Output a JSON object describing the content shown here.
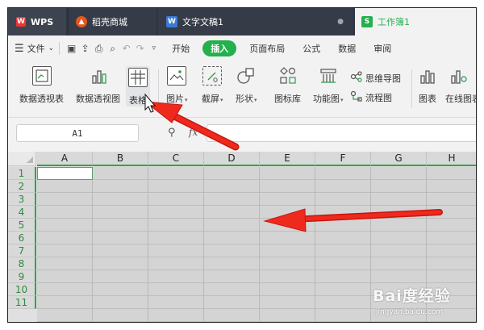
{
  "tabs": [
    {
      "label": "WPS",
      "icon": "wps-logo-icon"
    },
    {
      "label": "稻壳商城",
      "icon": "docer-flame-icon"
    },
    {
      "label": "文字文稿1",
      "icon": "writer-doc-icon",
      "close": "●"
    },
    {
      "label": "工作簿1",
      "icon": "spreadsheet-icon"
    }
  ],
  "menubar": {
    "file_label": "文件",
    "quick_icons": [
      "save-icon",
      "share-icon",
      "print-icon",
      "print-preview-icon",
      "undo-icon",
      "redo-icon",
      "quick-access-dropdown-icon"
    ],
    "tabs": [
      "开始",
      "插入",
      "页面布局",
      "公式",
      "数据",
      "审阅"
    ],
    "active_tab": "插入"
  },
  "ribbon": {
    "pivot_table": "数据透视表",
    "pivot_chart": "数据透视图",
    "table": "表格",
    "picture": "图片",
    "screenshot": "截屏",
    "shapes": "形状",
    "icon_library": "图标库",
    "function_chart": "功能图",
    "mind_map": "思维导图",
    "flowchart": "流程图",
    "chart": "图表",
    "online_chart": "在线图表"
  },
  "formula_bar": {
    "cell_ref": "A1",
    "zoom_icon": "magnifier-icon",
    "fx_label": "fx"
  },
  "sheet": {
    "columns": [
      "A",
      "B",
      "C",
      "D",
      "E",
      "F",
      "G",
      "H"
    ],
    "rows": [
      "1",
      "2",
      "3",
      "4",
      "5",
      "6",
      "7",
      "8",
      "9",
      "10",
      "11"
    ],
    "active_cell": "A1"
  },
  "colors": {
    "accent_green": "#24b04d",
    "arrow_red": "#e8231b",
    "tabbar_bg": "#2e3542"
  },
  "watermark": {
    "logo_text": "Bai度经验",
    "url": "jingyan.baidu.com"
  }
}
